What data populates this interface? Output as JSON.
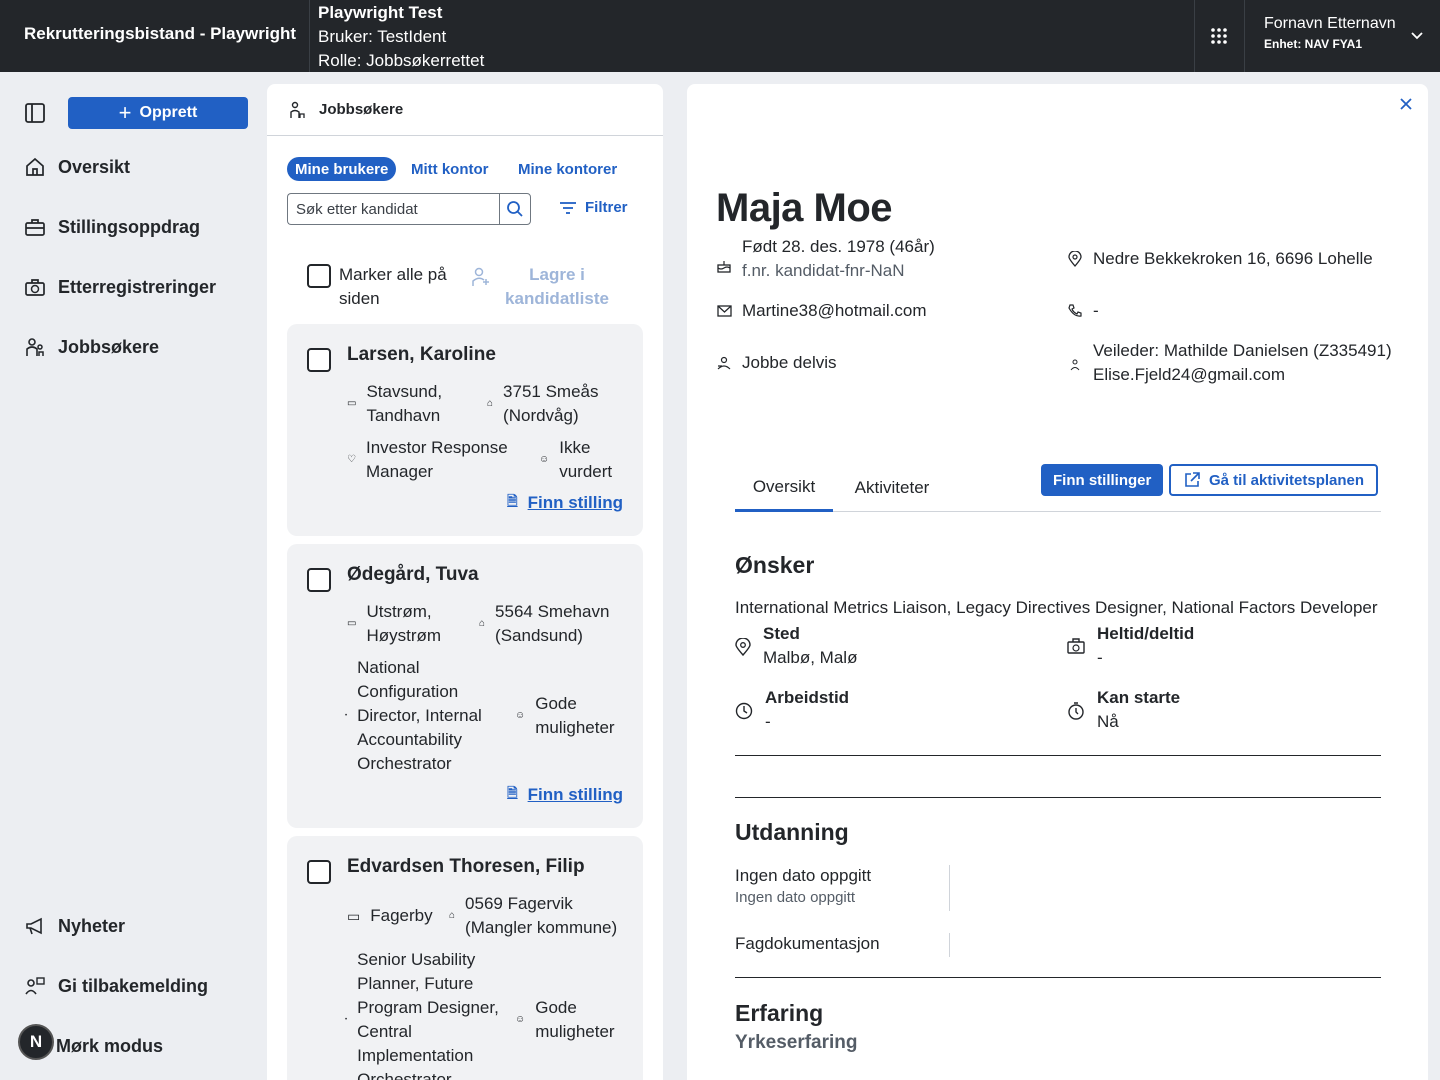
{
  "topbar": {
    "app_title": "Rekrutteringsbistand - Playwright",
    "env_title": "Playwright Test",
    "env_user": "Bruker: TestIdent",
    "env_role": "Rolle: Jobbsøkerrettet",
    "user_name": "Fornavn Etternavn",
    "user_unit": "Enhet: NAV FYA1"
  },
  "sidebar": {
    "create_label": "Opprett",
    "items": [
      {
        "label": "Oversikt",
        "icon": "house-icon"
      },
      {
        "label": "Stillingsoppdrag",
        "icon": "briefcase-icon"
      },
      {
        "label": "Etterregistreringer",
        "icon": "briefcase-clock-icon"
      },
      {
        "label": "Jobbsøkere",
        "icon": "people-icon"
      }
    ],
    "bottom_items": [
      {
        "label": "Nyheter",
        "icon": "megaphone-icon"
      },
      {
        "label": "Gi tilbakemelding",
        "icon": "feedback-icon"
      }
    ],
    "dark_mode_badge": "N",
    "dark_mode_label": "Mørk modus"
  },
  "middle": {
    "title": "Jobbsøkere",
    "chips": [
      "Mine brukere",
      "Mitt kontor",
      "Mine kontorer"
    ],
    "search_placeholder": "Søk etter kandidat",
    "filter_label": "Filtrer",
    "mark_all_label": "Marker alle på siden",
    "save_list_label": "Lagre i kandidatliste",
    "candidates": [
      {
        "name": "Larsen, Karoline",
        "address": "Stavsund, Tandhavn",
        "postal": "3751 Smeås (Nordvåg)",
        "job": "Investor Response Manager",
        "status": "Ikke vurdert",
        "link": "Finn stilling"
      },
      {
        "name": "Ødegård, Tuva",
        "address": "Utstrøm, Høystrøm",
        "postal": "5564 Smehavn (Sandsund)",
        "job": "National Configuration Director, Internal Accountability Orchestrator",
        "status": "Gode muligheter",
        "link": "Finn stilling"
      },
      {
        "name": "Edvardsen Thoresen, Filip",
        "address": "Fagerby",
        "postal": "0569 Fagervik (Mangler kommune)",
        "job": "Senior Usability Planner, Future Program Designer, Central Implementation Orchestrator",
        "status": "Gode muligheter"
      }
    ]
  },
  "detail": {
    "name": "Maja Moe",
    "born": "Født 28. des. 1978 (46år)",
    "fnr": "f.nr. kandidat-fnr-NaN",
    "address": "Nedre Bekkekroken 16, 6696 Lohelle",
    "email": "Martine38@hotmail.com",
    "phone": "-",
    "innsats": "Jobbe delvis",
    "veileder": "Veileder: Mathilde Danielsen (Z335491)",
    "veileder_email": "Elise.Fjeld24@gmail.com",
    "tabs": [
      "Oversikt",
      "Aktiviteter"
    ],
    "btn_find_jobs": "Finn stillinger",
    "btn_activity_plan": "Gå til aktivitetsplanen",
    "wishes": {
      "title": "Ønsker",
      "jobs": "International Metrics Liaison, Legacy Directives Designer, National Factors Developer",
      "place_label": "Sted",
      "place_value": "Malbø, Malø",
      "hours_label": "Heltid/deltid",
      "hours_value": "-",
      "worktime_label": "Arbeidstid",
      "worktime_value": "-",
      "start_label": "Kan starte",
      "start_value": "Nå"
    },
    "education": {
      "title": "Utdanning",
      "row1_title": "Ingen dato oppgitt",
      "row1_sub": "Ingen dato oppgitt",
      "row2_title": "Fagdokumentasjon"
    },
    "experience": {
      "title": "Erfaring",
      "subtitle": "Yrkeserfaring"
    }
  }
}
